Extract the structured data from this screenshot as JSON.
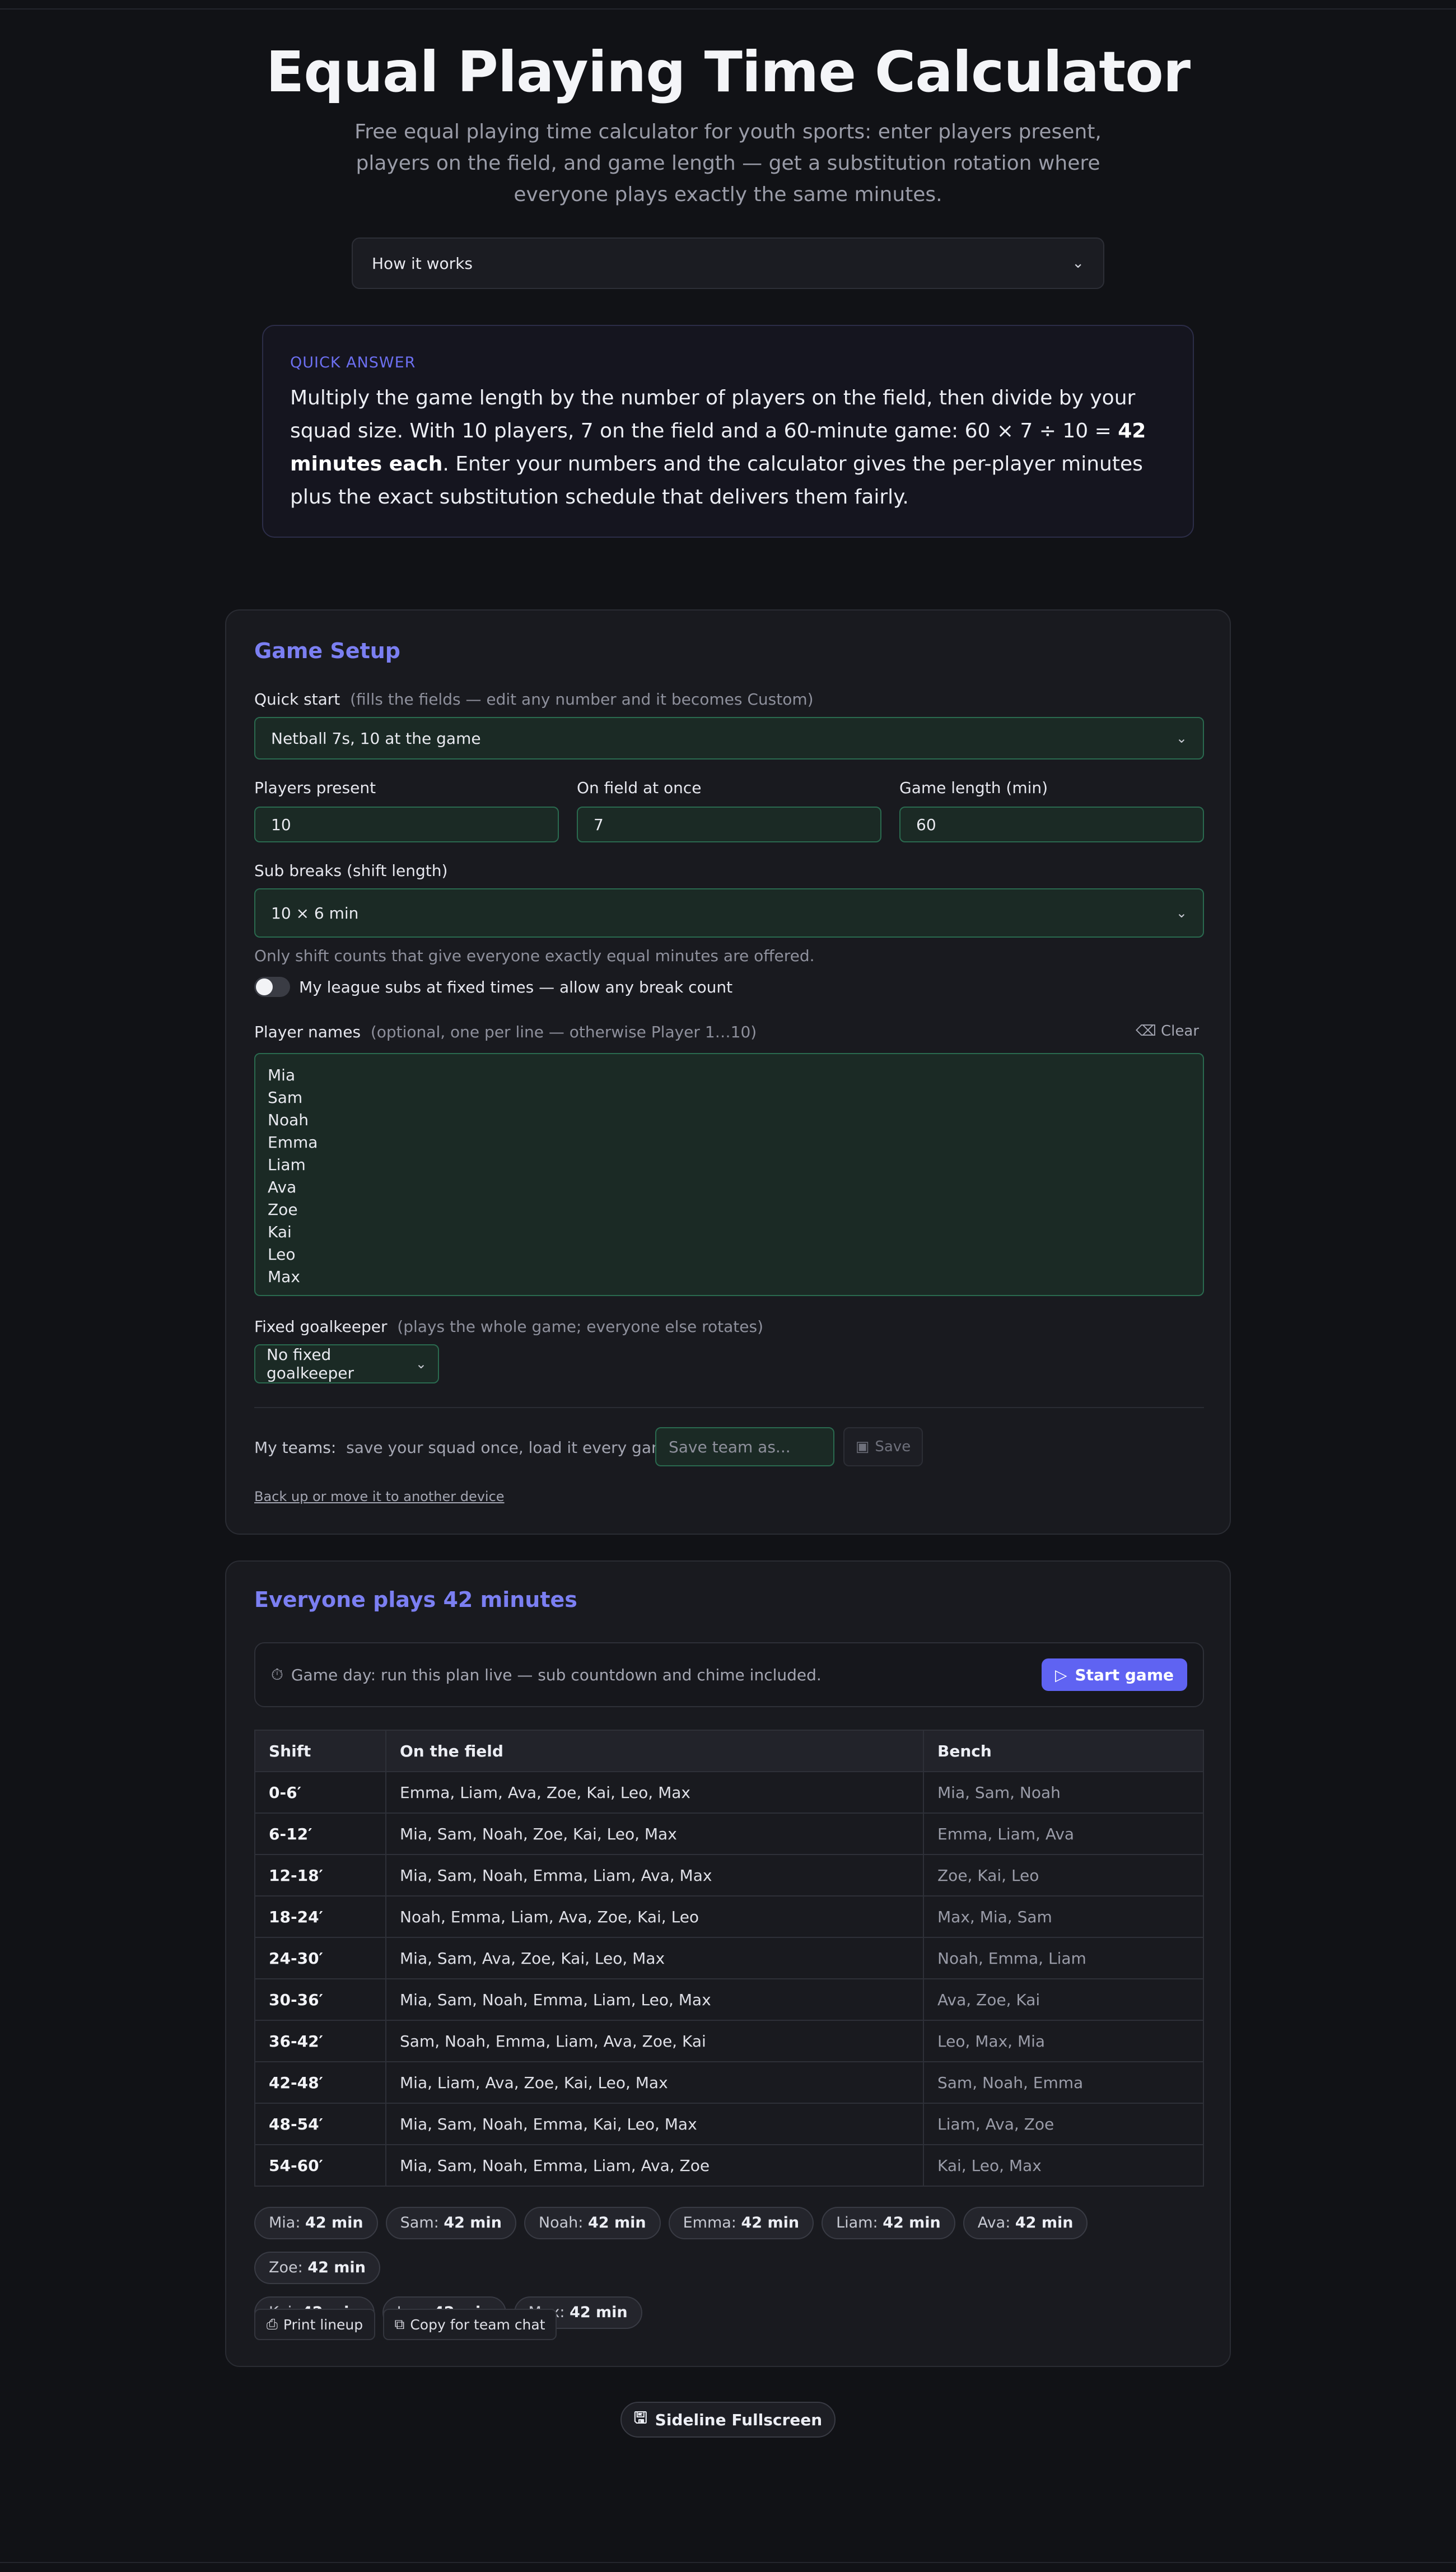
{
  "page": {
    "title": "Equal Playing Time Calculator",
    "subtitle": "Free equal playing time calculator for youth sports: enter players present, players on the field, and game length — get a substitution rotation where everyone plays exactly the same minutes.",
    "how_it_works": "How it works"
  },
  "quick_answer": {
    "label": "QUICK ANSWER",
    "text_before": "Multiply the game length by the number of players on the field, then divide by your squad size. With 10 players, 7 on the field and a 60-minute game: 60 × 7 ÷ 10 = ",
    "text_bold": "42 minutes each",
    "text_after": ". Enter your numbers and the calculator gives the per-player minutes plus the exact substitution schedule that delivers them fairly."
  },
  "setup": {
    "title": "Game Setup",
    "quick_start_label": "Quick start",
    "quick_start_hint": "(fills the fields — edit any number and it becomes Custom)",
    "quick_start_value": "Netball 7s, 10 at the game",
    "players_present_label": "Players present",
    "players_present_value": "10",
    "on_field_label": "On field at once",
    "on_field_value": "7",
    "game_length_label": "Game length (min)",
    "game_length_value": "60",
    "sub_breaks_label": "Sub breaks (shift length)",
    "sub_breaks_value": "10 × 6 min",
    "equal_note": "Only shift counts that give everyone exactly equal minutes are offered.",
    "toggle_label": "My league subs at fixed times — allow any break count",
    "player_names_label": "Player names",
    "player_names_hint": "(optional, one per line — otherwise Player 1…10)",
    "clear_label": "Clear",
    "player_names": [
      "Mia",
      "Sam",
      "Noah",
      "Emma",
      "Liam",
      "Ava",
      "Zoe",
      "Kai",
      "Leo",
      "Max"
    ],
    "goalkeeper_label": "Fixed goalkeeper",
    "goalkeeper_hint": "(plays the whole game; everyone else rotates)",
    "goalkeeper_value": "No fixed goalkeeper",
    "my_teams_label": "My teams:",
    "my_teams_hint": "save your squad once, load it every game —",
    "save_placeholder": "Save team as...",
    "save_label": "Save",
    "backup_link": "Back up or move it to another device"
  },
  "plan": {
    "title": "Everyone plays 42 minutes",
    "gameday_text": "Game day: run this plan live — sub countdown and chime included.",
    "start_label": "Start game",
    "columns": [
      "Shift",
      "On the field",
      "Bench"
    ],
    "rows": [
      {
        "shift": "0-6′",
        "field": "Emma, Liam, Ava, Zoe, Kai, Leo, Max",
        "bench": "Mia, Sam, Noah"
      },
      {
        "shift": "6-12′",
        "field": "Mia, Sam, Noah, Zoe, Kai, Leo, Max",
        "bench": "Emma, Liam, Ava"
      },
      {
        "shift": "12-18′",
        "field": "Mia, Sam, Noah, Emma, Liam, Ava, Max",
        "bench": "Zoe, Kai, Leo"
      },
      {
        "shift": "18-24′",
        "field": "Noah, Emma, Liam, Ava, Zoe, Kai, Leo",
        "bench": "Max, Mia, Sam"
      },
      {
        "shift": "24-30′",
        "field": "Mia, Sam, Ava, Zoe, Kai, Leo, Max",
        "bench": "Noah, Emma, Liam"
      },
      {
        "shift": "30-36′",
        "field": "Mia, Sam, Noah, Emma, Liam, Leo, Max",
        "bench": "Ava, Zoe, Kai"
      },
      {
        "shift": "36-42′",
        "field": "Sam, Noah, Emma, Liam, Ava, Zoe, Kai",
        "bench": "Leo, Max, Mia"
      },
      {
        "shift": "42-48′",
        "field": "Mia, Liam, Ava, Zoe, Kai, Leo, Max",
        "bench": "Sam, Noah, Emma"
      },
      {
        "shift": "48-54′",
        "field": "Mia, Sam, Noah, Emma, Kai, Leo, Max",
        "bench": "Liam, Ava, Zoe"
      },
      {
        "shift": "54-60′",
        "field": "Mia, Sam, Noah, Emma, Liam, Ava, Zoe",
        "bench": "Kai, Leo, Max"
      }
    ],
    "totals": [
      {
        "name": "Mia:",
        "minutes": "42 min"
      },
      {
        "name": "Sam:",
        "minutes": "42 min"
      },
      {
        "name": "Noah:",
        "minutes": "42 min"
      },
      {
        "name": "Emma:",
        "minutes": "42 min"
      },
      {
        "name": "Liam:",
        "minutes": "42 min"
      },
      {
        "name": "Ava:",
        "minutes": "42 min"
      },
      {
        "name": "Zoe:",
        "minutes": "42 min"
      },
      {
        "name": "Kai:",
        "minutes": "42 min"
      },
      {
        "name": "Leo:",
        "minutes": "42 min"
      },
      {
        "name": "Max:",
        "minutes": "42 min"
      }
    ],
    "print_label": "Print lineup",
    "copy_label": "Copy for team chat"
  },
  "sideline_label": "Sideline Fullscreen",
  "colors": {
    "accent": "#5f63f2",
    "title_accent": "#7b7ff2",
    "field_bg": "#1b2a25",
    "field_border": "#2a6a4f",
    "page_bg": "#111216"
  }
}
